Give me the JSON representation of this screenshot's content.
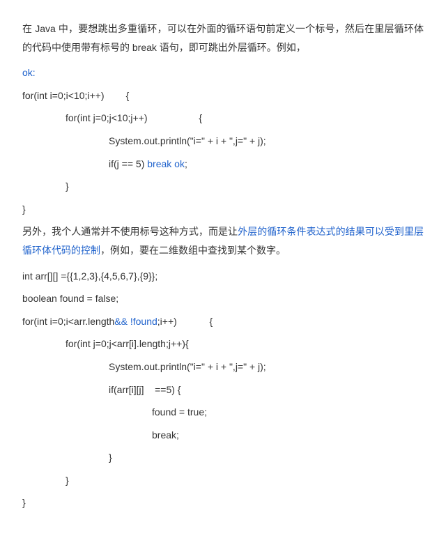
{
  "para1_head": "在 Java 中，要想跳出多重循环，可以在外面的循环语句前定义一个标号，然后在里层循环体的代码中使用带有标号的 break 语句，即可跳出外层循环。例如，",
  "label_ok": "ok:",
  "c1_for_outer": "for(int i=0;i<10;i++)        {",
  "c1_for_inner": "for(int j=0;j<10;j++)                   {",
  "c1_print": "System.out.println(\"i=\" + i + \",j=\" + j);",
  "c1_if_prefix": "if(j == 5) ",
  "c1_break_ok": "break ok",
  "c1_if_suffix": ";",
  "c1_brace1": "}",
  "c1_brace2": "}",
  "para2_a": "另外，我个人通常并不使用标号这种方式，而是让",
  "para2_blue": "外层的循环条件表达式的结果可以受到里层循环体代码的控制",
  "para2_b": "，例如，要在二维数组中查找到某个数字。",
  "c2_arr": "int arr[][] ={{1,2,3},{4,5,6,7},{9}};",
  "c2_found": "boolean found = false;",
  "c2_for_outer_a": "for(int i=0;i<arr.length",
  "c2_for_outer_blue": "&& !found",
  "c2_for_outer_b": ";i++)            {",
  "c2_for_inner": "for(int j=0;j<arr[i].length;j++){",
  "c2_print": "System.out.println(\"i=\" + i + \",j=\" + j);",
  "c2_if": "if(arr[i][j]    ==5) {",
  "c2_found_true": "found = true;",
  "c2_break": "break;",
  "c2_brace1": "}",
  "c2_brace2": "}",
  "c2_brace3": "}"
}
